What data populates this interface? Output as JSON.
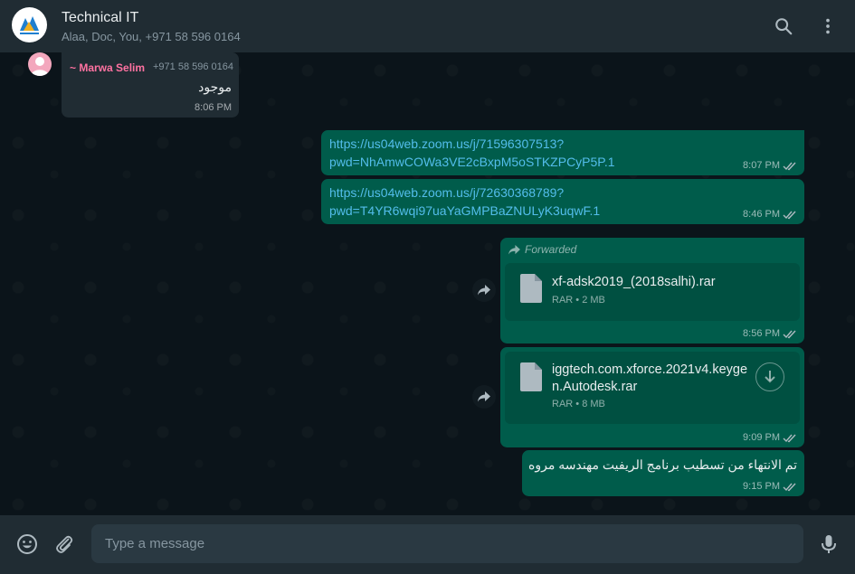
{
  "header": {
    "title": "Technical IT",
    "participants": "Alaa, Doc, You, +971 58 596 0164",
    "search_icon": "search-icon",
    "menu_icon": "kebab-menu-icon"
  },
  "messages": [
    {
      "direction": "in",
      "sender_name": "~ Marwa Selim",
      "sender_phone": "+971 58 596 0164",
      "text": "موجود",
      "time": "8:06 PM"
    },
    {
      "direction": "out",
      "line1": "https://us04web.zoom.us/j/71596307513?",
      "line2": "pwd=NhAmwCOWa3VE2cBxpM5oSTKZPCyP5P.1",
      "time": "8:07 PM"
    },
    {
      "direction": "out",
      "line1": "https://us04web.zoom.us/j/72630368789?",
      "line2": "pwd=T4YR6wqi97uaYaGMPBaZNULyK3uqwF.1",
      "time": "8:46 PM"
    },
    {
      "direction": "out",
      "forwarded_label": "Forwarded",
      "file_name": "xf-adsk2019_(2018salhi).rar",
      "file_info": "RAR • 2 MB",
      "time": "8:56 PM"
    },
    {
      "direction": "out",
      "file_name_line1": "iggtech.com.xforce.2021v4.keyge",
      "file_name_line2": "n.Autodesk.rar",
      "file_info": "RAR • 8 MB",
      "time": "9:09 PM"
    },
    {
      "direction": "out",
      "text": "تم الانتهاء من تسطيب برنامج الريفيت مهندسه مروه",
      "time": "9:15 PM"
    }
  ],
  "composer": {
    "placeholder": "Type a message",
    "emoji_icon": "emoji-icon",
    "attach_icon": "paperclip-icon",
    "mic_icon": "microphone-icon"
  },
  "colors": {
    "incoming_bubble": "#202c33",
    "outgoing_bubble": "#005c4b",
    "link": "#53bdeb",
    "sender_name": "#ff72a1"
  }
}
